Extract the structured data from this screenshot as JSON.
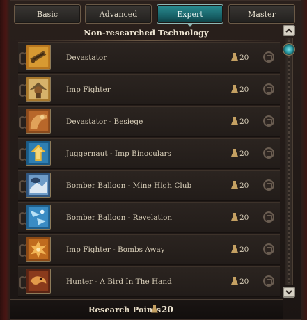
{
  "tabs": [
    {
      "label": "Basic",
      "active": false
    },
    {
      "label": "Advanced",
      "active": false
    },
    {
      "label": "Expert",
      "active": true
    },
    {
      "label": "Master",
      "active": false
    }
  ],
  "panel": {
    "title": "Non-researched Technology"
  },
  "items": [
    {
      "name": "Devastator",
      "cost": "20",
      "icon": "devastator-icon"
    },
    {
      "name": "Imp Fighter",
      "cost": "20",
      "icon": "imp-fighter-icon"
    },
    {
      "name": "Devastator - Besiege",
      "cost": "20",
      "icon": "besiege-icon"
    },
    {
      "name": "Juggernaut - Imp Binoculars",
      "cost": "20",
      "icon": "binoculars-icon"
    },
    {
      "name": "Bomber Balloon - Mine High Club",
      "cost": "20",
      "icon": "mine-high-club-icon"
    },
    {
      "name": "Bomber Balloon - Revelation",
      "cost": "20",
      "icon": "revelation-icon"
    },
    {
      "name": "Imp Fighter - Bombs Away",
      "cost": "20",
      "icon": "bombs-away-icon"
    },
    {
      "name": "Hunter - A Bird In The Hand",
      "cost": "20",
      "icon": "bird-in-hand-icon"
    }
  ],
  "footer": {
    "label": "Research Points",
    "value": "20",
    "icon": "research-flask-icon"
  },
  "colors": {
    "accent": "#1f8088",
    "text": "#d9cfb9",
    "row_bg": "#272019"
  }
}
